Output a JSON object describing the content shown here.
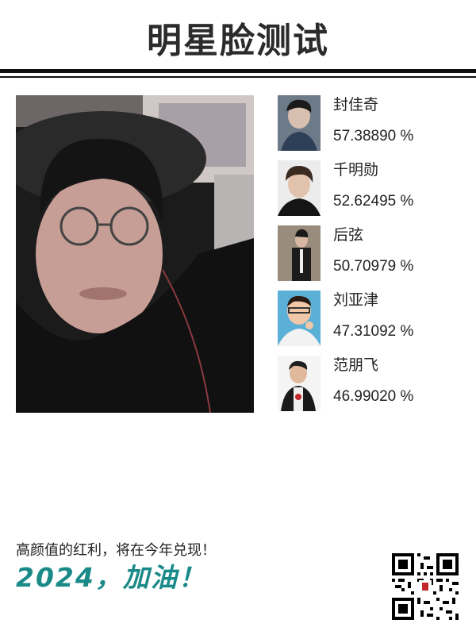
{
  "header": {
    "title": "明星脸测试"
  },
  "main_photo": {
    "alt": "user-face-photo"
  },
  "matches": [
    {
      "name": "封佳奇",
      "score": "57.38890 %"
    },
    {
      "name": "千明勋",
      "score": "52.62495 %"
    },
    {
      "name": "后弦",
      "score": "50.70979 %"
    },
    {
      "name": "刘亚津",
      "score": "47.31092 %"
    },
    {
      "name": "范朋飞",
      "score": "46.99020 %"
    }
  ],
  "footer": {
    "slogan": "高颜值的红利，将在今年兑现！",
    "cheer": "2024，加油！"
  },
  "colors": {
    "accent": "#1a8a88",
    "text": "#222222",
    "rule": "#111111"
  }
}
